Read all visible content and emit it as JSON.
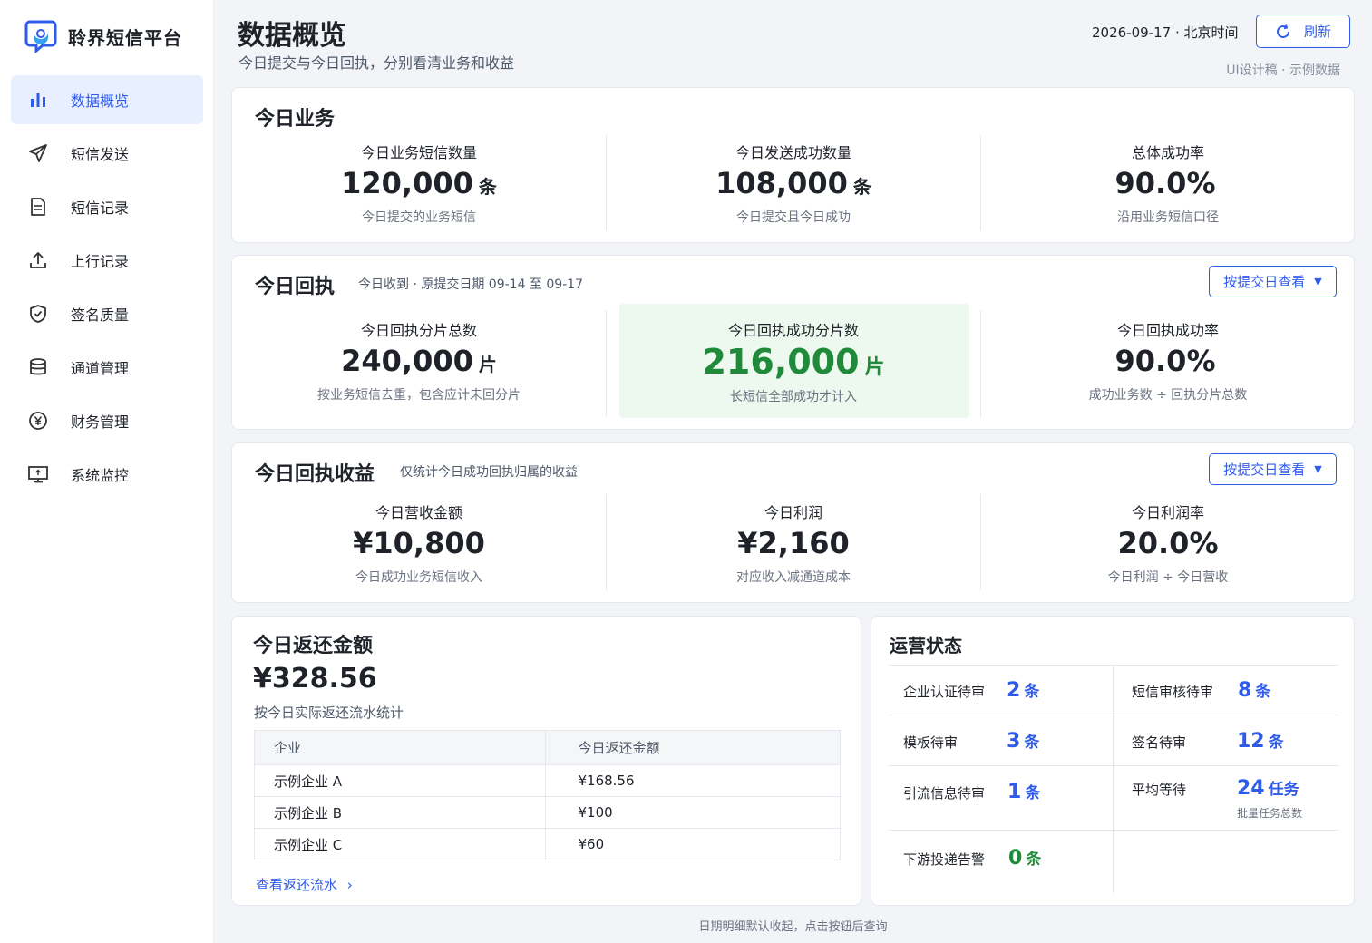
{
  "app": {
    "name": "聆界短信平台"
  },
  "sidebar": {
    "items": [
      {
        "label": "数据概览",
        "icon": "bar-chart-icon",
        "active": true
      },
      {
        "label": "短信发送",
        "icon": "send-icon"
      },
      {
        "label": "短信记录",
        "icon": "document-icon"
      },
      {
        "label": "上行记录",
        "icon": "upload-icon"
      },
      {
        "label": "签名质量",
        "icon": "shield-check-icon"
      },
      {
        "label": "通道管理",
        "icon": "database-icon"
      },
      {
        "label": "财务管理",
        "icon": "yen-icon"
      },
      {
        "label": "系统监控",
        "icon": "monitor-icon"
      }
    ]
  },
  "header": {
    "title": "数据概览",
    "subtitle": "今日提交与今日回执，分别看清业务和收益",
    "date": "2026-09-17 · 北京时间",
    "refresh_label": "刷新",
    "note": "UI设计稿 · 示例数据"
  },
  "business": {
    "title": "今日业务",
    "metrics": [
      {
        "label": "今日业务短信数量",
        "value": "120,000",
        "unit": "条",
        "note": "今日提交的业务短信"
      },
      {
        "label": "今日发送成功数量",
        "value": "108,000",
        "unit": "条",
        "note": "今日提交且今日成功"
      },
      {
        "label": "总体成功率",
        "value": "90.0%",
        "unit": "",
        "note": "沿用业务短信口径"
      }
    ]
  },
  "receipt": {
    "title": "今日回执",
    "desc": "今日收到 · 原提交日期 09-14 至 09-17",
    "select_label": "按提交日查看",
    "metrics": [
      {
        "label": "今日回执分片总数",
        "value": "240,000",
        "unit": "片",
        "note": "按业务短信去重，包含应计未回分片"
      },
      {
        "label": "今日回执成功分片数",
        "value": "216,000",
        "unit": "片",
        "note": "长短信全部成功才计入"
      },
      {
        "label": "今日回执成功率",
        "value": "90.0%",
        "unit": "",
        "note": "成功业务数 ÷ 回执分片总数"
      }
    ]
  },
  "revenue": {
    "title": "今日回执收益",
    "desc": "仅统计今日成功回执归属的收益",
    "select_label": "按提交日查看",
    "metrics": [
      {
        "label": "今日营收金额",
        "value": "¥10,800",
        "unit": "",
        "note": "今日成功业务短信收入"
      },
      {
        "label": "今日利润",
        "value": "¥2,160",
        "unit": "",
        "note": "对应收入减通道成本"
      },
      {
        "label": "今日利润率",
        "value": "20.0%",
        "unit": "",
        "note": "今日利润 ÷ 今日营收"
      }
    ]
  },
  "refund": {
    "title": "今日返还金额",
    "amount": "¥328.56",
    "desc": "按今日实际返还流水统计",
    "columns": [
      "企业",
      "今日返还金额"
    ],
    "rows": [
      [
        "示例企业 A",
        "¥168.56"
      ],
      [
        "示例企业 B",
        "¥100"
      ],
      [
        "示例企业 C",
        "¥60"
      ]
    ],
    "link_label": "查看返还流水"
  },
  "ops": {
    "title": "运营状态",
    "items": [
      {
        "label": "企业认证待审",
        "value": "2",
        "unit": "条"
      },
      {
        "label": "短信审核待审",
        "value": "8",
        "unit": "条"
      },
      {
        "label": "模板待审",
        "value": "3",
        "unit": "条"
      },
      {
        "label": "签名待审",
        "value": "12",
        "unit": "条"
      },
      {
        "label": "引流信息待审",
        "value": "1",
        "unit": "条"
      },
      {
        "label": "平均等待",
        "value": "24",
        "unit": "任务",
        "sub": "批量任务总数"
      },
      {
        "label": "下游投递告警",
        "value": "0",
        "unit": "条"
      }
    ]
  },
  "footer": {
    "text": "日期明细默认收起，点击按钮后查询"
  },
  "colors": {
    "accent": "#2f5bea",
    "success": "#1f8a3a",
    "highlight_bg": "#edf8ee"
  }
}
